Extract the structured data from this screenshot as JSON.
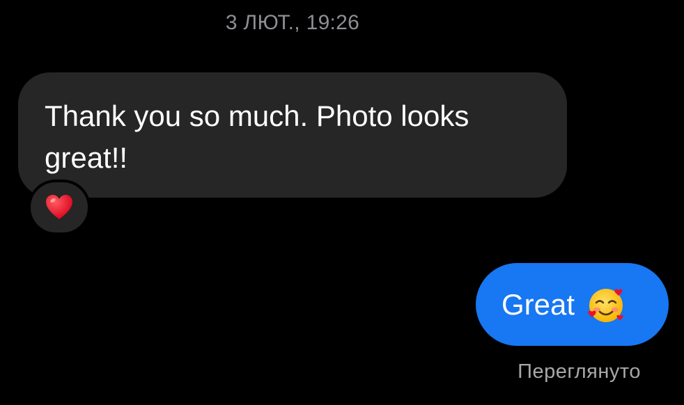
{
  "conversation": {
    "timestamp": "3 ЛЮТ., 19:26",
    "incoming_message": {
      "text": "Thank you so much. Photo looks great!!",
      "reaction_icon": "red-heart-emoji"
    },
    "outgoing_message": {
      "text": "Great",
      "emoji_icon": "smiling-face-with-hearts-emoji"
    },
    "seen_status": "Переглянуто"
  },
  "colors": {
    "background": "#000000",
    "incoming_bubble": "#262626",
    "outgoing_bubble": "#1877f2",
    "timestamp_text": "#8e8e93",
    "seen_text": "#a8a8a8"
  }
}
